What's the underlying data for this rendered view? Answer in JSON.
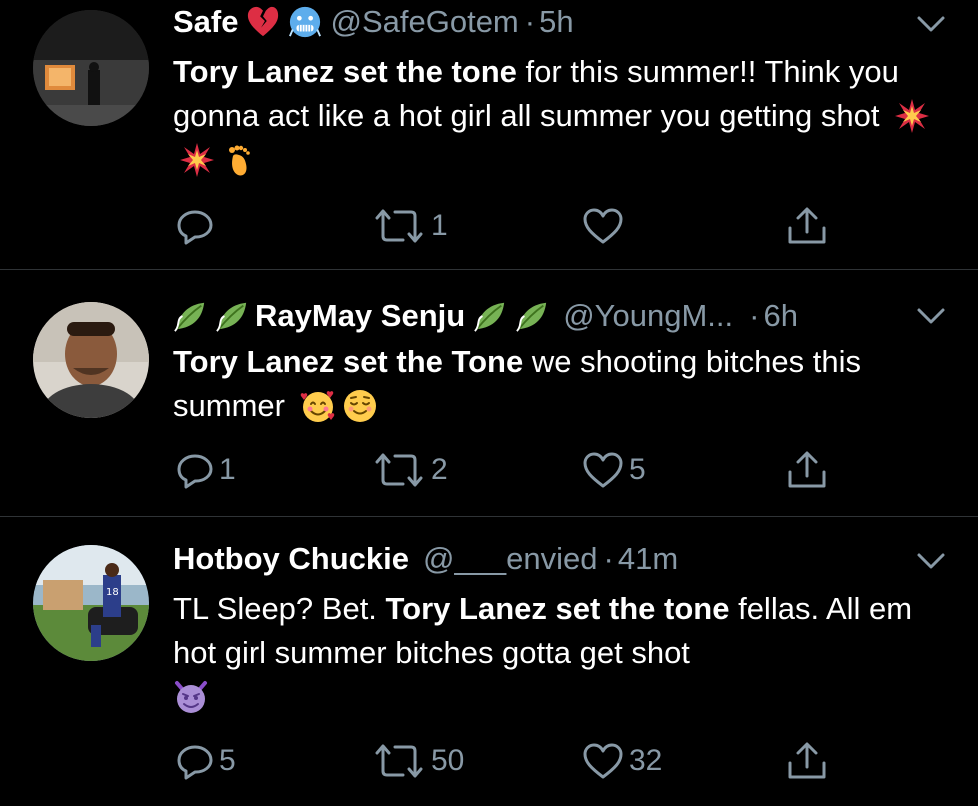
{
  "tweets": [
    {
      "name": "Safe",
      "name_emojis": [
        "broken-heart",
        "cold-face"
      ],
      "handle": "@SafeGotem",
      "dot": "·",
      "time": "5h",
      "text": {
        "bold": "Tory Lanez set the tone",
        "rest": " for this summer!! Think you gonna act like a hot girl all summer you getting shot",
        "emojis": [
          "collision",
          "collision",
          "foot"
        ]
      },
      "actions": {
        "reply": "",
        "retweet": "1",
        "like": "",
        "share": ""
      }
    },
    {
      "name": "RayMay Senju",
      "name_emojis": [
        "leaf",
        "leaf",
        "leaf",
        "leaf"
      ],
      "handle": "@YoungM...",
      "dot": "·",
      "time": "6h",
      "text": {
        "bold": "Tory Lanez set the Tone",
        "rest": " we shooting bitches this summer",
        "emojis": [
          "smiling-face-with-hearts",
          "relieved-face"
        ]
      },
      "actions": {
        "reply": "1",
        "retweet": "2",
        "like": "5",
        "share": ""
      }
    },
    {
      "name": "Hotboy Chuckie",
      "handle": "@___envied",
      "dot": "·",
      "time": "41m",
      "text": {
        "pre": "TL Sleep? Bet. ",
        "bold": "Tory Lanez set the tone",
        "rest": " fellas. All em hot girl summer bitches gotta get shot",
        "emojis": [
          "smiling-imp"
        ]
      },
      "actions": {
        "reply": "5",
        "retweet": "50",
        "like": "32",
        "share": ""
      }
    }
  ],
  "colors": {
    "background": "#000000",
    "text": "#ffffff",
    "secondary": "#8899a6",
    "divider": "#2f3336"
  }
}
